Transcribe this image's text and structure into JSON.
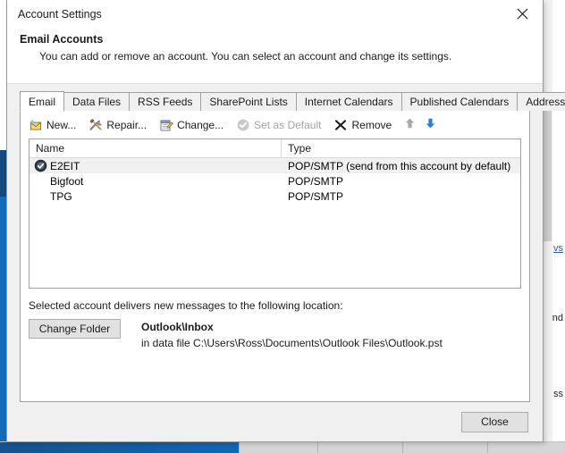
{
  "window": {
    "title": "Account Settings",
    "close_icon": "close-x-icon"
  },
  "header": {
    "title": "Email Accounts",
    "description": "You can add or remove an account. You can select an account and change its settings."
  },
  "tabs": [
    {
      "label": "Email",
      "active": true
    },
    {
      "label": "Data Files",
      "active": false
    },
    {
      "label": "RSS Feeds",
      "active": false
    },
    {
      "label": "SharePoint Lists",
      "active": false
    },
    {
      "label": "Internet Calendars",
      "active": false
    },
    {
      "label": "Published Calendars",
      "active": false
    },
    {
      "label": "Address Books",
      "active": false
    }
  ],
  "toolbar": {
    "new_label": "New...",
    "repair_label": "Repair...",
    "change_label": "Change...",
    "set_default_label": "Set as Default",
    "remove_label": "Remove",
    "move_up_icon": "arrow-up-icon",
    "move_down_icon": "arrow-down-icon"
  },
  "accounts_list": {
    "columns": [
      "Name",
      "Type"
    ],
    "rows": [
      {
        "name": "E2EIT",
        "type": "POP/SMTP (send from this account by default)",
        "selected": true,
        "is_default": true
      },
      {
        "name": "Bigfoot",
        "type": "POP/SMTP",
        "selected": false,
        "is_default": false
      },
      {
        "name": "TPG",
        "type": "POP/SMTP",
        "selected": false,
        "is_default": false
      }
    ]
  },
  "delivery": {
    "label": "Selected account delivers new messages to the following location:",
    "change_folder_label": "Change Folder",
    "folder": "Outlook\\Inbox",
    "data_file": "in data file C:\\Users\\Ross\\Documents\\Outlook Files\\Outlook.pst"
  },
  "footer": {
    "close_label": "Close"
  },
  "background": {
    "link_fragment": "vs",
    "text_fragment": "nd",
    "text_fragment_2": "ss"
  },
  "colors": {
    "accent_blue": "#0f6cbd",
    "dialog_bg": "#f0f0f0",
    "selection": "#f0f0f0",
    "disabled_text": "#a6a6a6"
  }
}
